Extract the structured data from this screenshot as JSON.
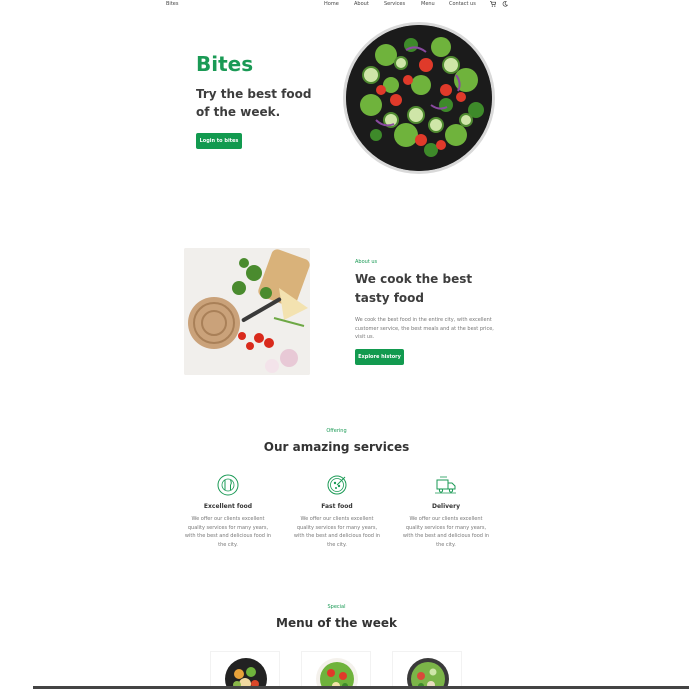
{
  "nav": {
    "brand": "Bites",
    "links": [
      "Home",
      "About",
      "Services",
      "Menu",
      "Contact us"
    ],
    "cart_icon": "cart-icon",
    "theme_icon": "moon-icon"
  },
  "hero": {
    "title": "Bites",
    "subtitle": "Try the best food of the week.",
    "button": "Login to bites"
  },
  "about": {
    "kicker": "About us",
    "title": "We cook the best tasty food",
    "text": "We cook the best food in the entire city, with excellent customer service, the best meals and at the best price, visit us.",
    "button": "Explore history"
  },
  "services": {
    "kicker": "Offering",
    "title": "Our amazing services",
    "items": [
      {
        "icon": "cutlery-plate-icon",
        "title": "Excellent food",
        "text": "We offer our clients excellent quality services for many years, with the best and delicious food in the city."
      },
      {
        "icon": "pizza-icon",
        "title": "Fast food",
        "text": "We offer our clients excellent quality services for many years, with the best and delicious food in the city."
      },
      {
        "icon": "delivery-truck-icon",
        "title": "Delivery",
        "text": "We offer our clients excellent quality services for many years, with the best and delicious food in the city."
      }
    ]
  },
  "menu": {
    "kicker": "Special",
    "title": "Menu of the week"
  },
  "colors": {
    "accent": "#129a4f",
    "heading": "#3d3d3d",
    "muted": "#777777"
  }
}
